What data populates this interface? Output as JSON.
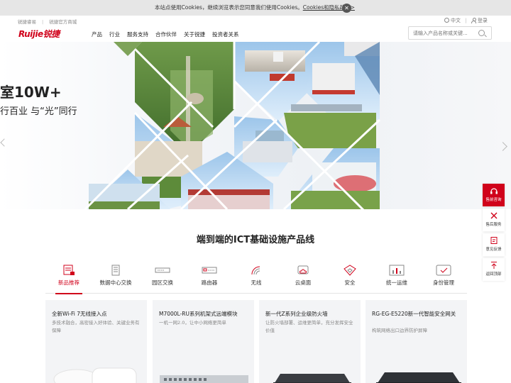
{
  "cookie": {
    "text": "本站点使用Cookies，继续浏览表示您同意我们使用Cookies。",
    "link": "Cookies和隐私政策>"
  },
  "utility": {
    "left": [
      "锐捷睿易",
      "锐捷官方商城"
    ],
    "lang": "中文",
    "login": "登录"
  },
  "logo": "Ruijie锐捷",
  "nav": [
    "产品",
    "行业",
    "服务支持",
    "合作伙伴",
    "关于锐捷",
    "投资者关系"
  ],
  "search": {
    "placeholder": "请输入产品名称或关键..."
  },
  "hero": {
    "title": "室10W+",
    "subtitle": "行百业 与“光”同行"
  },
  "section_title": "端到端的ICT基础设施产品线",
  "categories": [
    {
      "label": "新品推荐",
      "icon": "new-product-icon",
      "active": true
    },
    {
      "label": "数据中心交换",
      "icon": "datacenter-switch-icon"
    },
    {
      "label": "园区交换",
      "icon": "campus-switch-icon"
    },
    {
      "label": "路由器",
      "icon": "router-icon"
    },
    {
      "label": "无线",
      "icon": "wireless-icon"
    },
    {
      "label": "云桌面",
      "icon": "cloud-desktop-icon"
    },
    {
      "label": "安全",
      "icon": "security-shield-icon"
    },
    {
      "label": "统一运维",
      "icon": "unified-ops-icon"
    },
    {
      "label": "身份管理",
      "icon": "identity-icon"
    }
  ],
  "products": [
    {
      "title": "全新Wi-Fi 7无线接入点",
      "desc": "多技术融合，高密接入好体验、关键业务有保障"
    },
    {
      "title": "M7000L-RU系列机架式远端模块",
      "desc": "一机一网2.0，让中小网络更简单"
    },
    {
      "title": "新一代Z系列企业级防火墙",
      "desc": "让防火墙部署、运维更简单，充分发挥安全价值"
    },
    {
      "title": "RG-EG-E5220新一代智能安全网关",
      "desc": "构筑网络出口边界防护屏障"
    }
  ],
  "float_tools": [
    "售前咨询",
    "售后服务",
    "意见反馈",
    "返回顶部"
  ],
  "colors": {
    "brand": "#d0021b"
  }
}
